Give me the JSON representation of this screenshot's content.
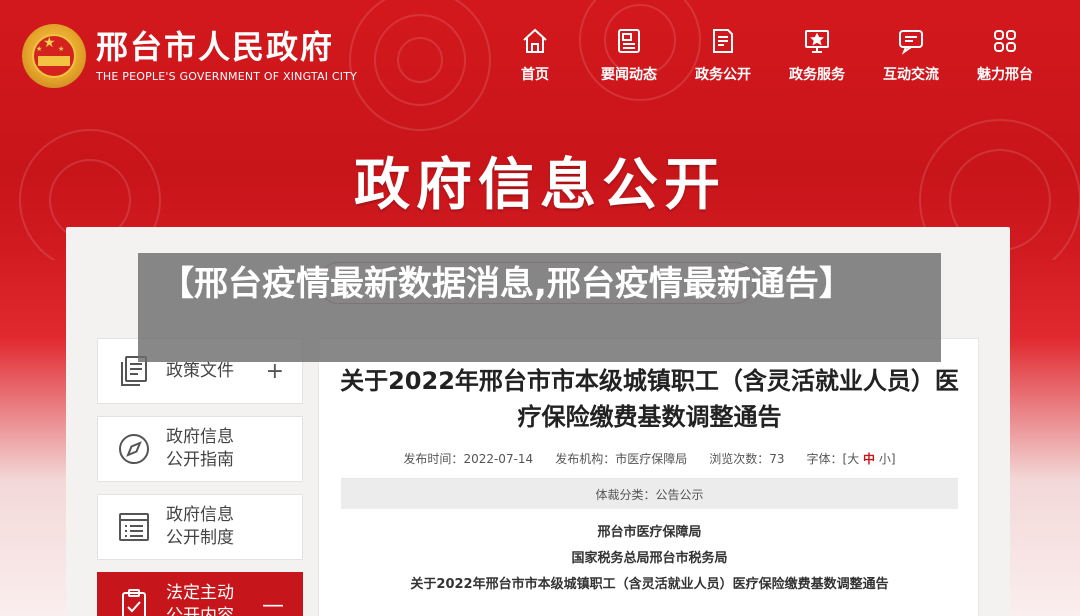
{
  "header": {
    "logo_cn": "邢台市人民政府",
    "logo_en": "THE PEOPLE'S GOVERNMENT OF XINGTAI CITY"
  },
  "nav": [
    {
      "label": "首页",
      "icon": "home-icon"
    },
    {
      "label": "要闻动态",
      "icon": "news-icon"
    },
    {
      "label": "政务公开",
      "icon": "document-icon"
    },
    {
      "label": "政务服务",
      "icon": "monitor-star-icon"
    },
    {
      "label": "互动交流",
      "icon": "chat-icon"
    },
    {
      "label": "魅力邢台",
      "icon": "grid-icon"
    }
  ],
  "hero_title": "政府信息公开",
  "overlay_title": "【邢台疫情最新数据消息,邢台疫情最新通告】",
  "sidebar": [
    {
      "label": "政策文件",
      "toggle": "+",
      "icon": "files-icon"
    },
    {
      "label": "政府信息公开指南",
      "toggle": "",
      "icon": "compass-icon"
    },
    {
      "label": "政府信息公开制度",
      "toggle": "",
      "icon": "list-icon"
    },
    {
      "label": "法定主动公开内容",
      "toggle": "—",
      "icon": "clipboard-icon"
    }
  ],
  "article": {
    "title": "关于2022年邢台市市本级城镇职工（含灵活就业人员）医疗保险缴费基数调整通告",
    "meta": {
      "date_label": "发布时间：",
      "date": "2022-07-14",
      "org_label": "发布机构：",
      "org": "市医疗保障局",
      "views_label": "浏览次数：",
      "views": "73",
      "font_label": "字体：",
      "font_open": "[大",
      "font_mid": "中",
      "font_close": "小]"
    },
    "category": "体裁分类：公告公示",
    "lines": [
      "邢台市医疗保障局",
      "国家税务总局邢台市税务局",
      "关于2022年邢台市市本级城镇职工（含灵活就业人员）医疗保险缴费基数调整通告"
    ]
  },
  "colors": {
    "brand_red": "#c7161b",
    "overlay_gray": "#6e6e6e"
  }
}
